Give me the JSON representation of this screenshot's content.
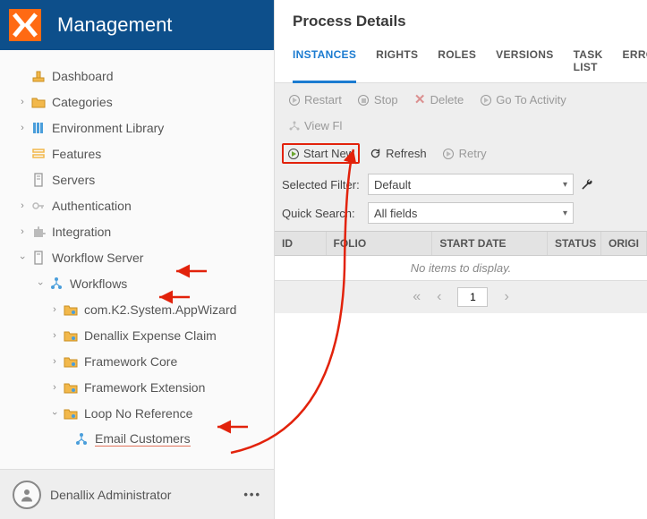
{
  "header": {
    "title": "Management"
  },
  "sidebar": {
    "items": [
      {
        "label": "Dashboard"
      },
      {
        "label": "Categories"
      },
      {
        "label": "Environment Library"
      },
      {
        "label": "Features"
      },
      {
        "label": "Servers"
      },
      {
        "label": "Authentication"
      },
      {
        "label": "Integration"
      },
      {
        "label": "Workflow Server"
      }
    ],
    "workflows_label": "Workflows",
    "wf_children": [
      {
        "label": "com.K2.System.AppWizard"
      },
      {
        "label": "Denallix Expense Claim"
      },
      {
        "label": "Framework Core"
      },
      {
        "label": "Framework Extension"
      },
      {
        "label": "Loop No Reference"
      }
    ],
    "leaf_label": "Email Customers"
  },
  "user": {
    "name": "Denallix Administrator"
  },
  "main": {
    "title": "Process Details",
    "tabs": [
      "INSTANCES",
      "RIGHTS",
      "ROLES",
      "VERSIONS",
      "TASK LIST",
      "ERRO"
    ],
    "toolbar": {
      "restart": "Restart",
      "stop": "Stop",
      "delete": "Delete",
      "goto": "Go To Activity",
      "viewflow": "View Fl",
      "startnew": "Start New",
      "refresh": "Refresh",
      "retry": "Retry"
    },
    "filter": {
      "label": "Selected Filter:",
      "value": "Default",
      "search_label": "Quick Search:",
      "search_value": "All fields"
    },
    "grid": {
      "columns": [
        "ID",
        "FOLIO",
        "START DATE",
        "STATUS",
        "ORIGI"
      ],
      "empty": "No items to display."
    },
    "pager": {
      "page": "1"
    }
  }
}
